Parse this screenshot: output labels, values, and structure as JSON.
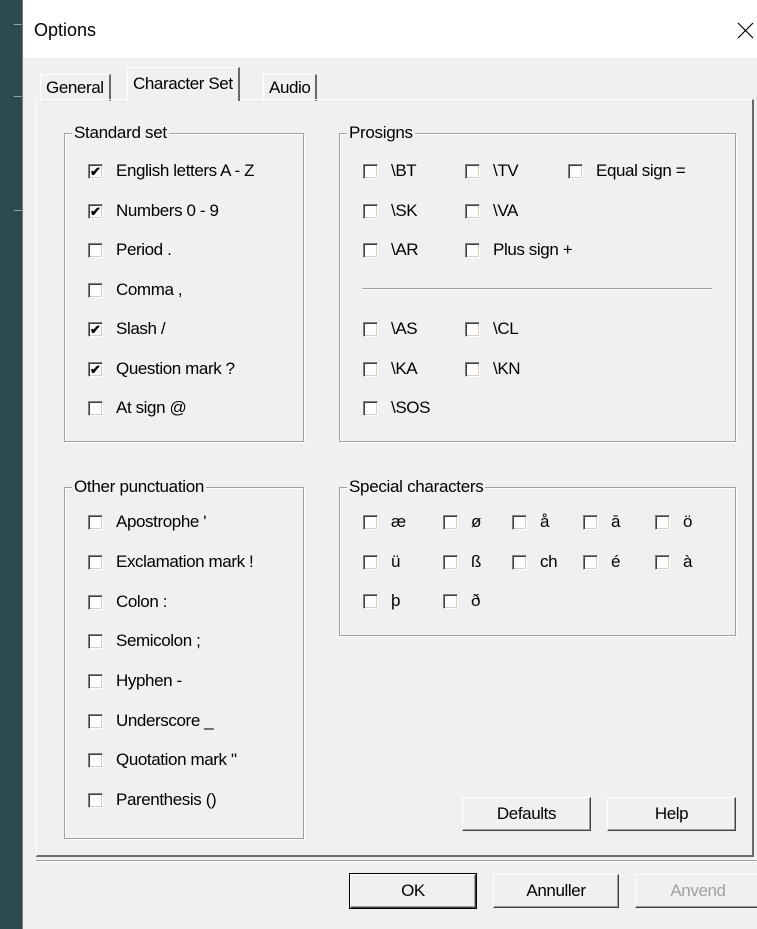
{
  "window": {
    "title": "Options"
  },
  "tabs": [
    {
      "label": "General",
      "active": false
    },
    {
      "label": "Character Set",
      "active": true
    },
    {
      "label": "Audio",
      "active": false
    }
  ],
  "standard_set": {
    "title": "Standard set",
    "items": [
      {
        "label": "English letters A - Z",
        "checked": true
      },
      {
        "label": "Numbers 0 - 9",
        "checked": true
      },
      {
        "label": "Period .",
        "checked": false
      },
      {
        "label": "Comma ,",
        "checked": false
      },
      {
        "label": "Slash /",
        "checked": true
      },
      {
        "label": "Question mark ?",
        "checked": true
      },
      {
        "label": "At sign @",
        "checked": false
      }
    ]
  },
  "prosigns": {
    "title": "Prosigns",
    "items": [
      {
        "label": "\\BT",
        "checked": false
      },
      {
        "label": "\\TV",
        "checked": false
      },
      {
        "label": "Equal sign =",
        "checked": false
      },
      {
        "label": "\\SK",
        "checked": false
      },
      {
        "label": "\\VA",
        "checked": false
      },
      {
        "label": "\\AR",
        "checked": false
      },
      {
        "label": "Plus sign +",
        "checked": false
      },
      {
        "label": "\\AS",
        "checked": false
      },
      {
        "label": "\\CL",
        "checked": false
      },
      {
        "label": "\\KA",
        "checked": false
      },
      {
        "label": "\\KN",
        "checked": false
      },
      {
        "label": "\\SOS",
        "checked": false
      }
    ]
  },
  "other_punctuation": {
    "title": "Other punctuation",
    "items": [
      {
        "label": "Apostrophe '",
        "checked": false
      },
      {
        "label": "Exclamation mark !",
        "checked": false
      },
      {
        "label": "Colon :",
        "checked": false
      },
      {
        "label": "Semicolon ;",
        "checked": false
      },
      {
        "label": "Hyphen -",
        "checked": false
      },
      {
        "label": "Underscore _",
        "checked": false
      },
      {
        "label": "Quotation mark \"",
        "checked": false
      },
      {
        "label": "Parenthesis ()",
        "checked": false
      }
    ]
  },
  "special_characters": {
    "title": "Special characters",
    "items": [
      {
        "label": "æ",
        "checked": false
      },
      {
        "label": "ø",
        "checked": false
      },
      {
        "label": "å",
        "checked": false
      },
      {
        "label": "ā",
        "checked": false
      },
      {
        "label": "ö",
        "checked": false
      },
      {
        "label": "ü",
        "checked": false
      },
      {
        "label": "ß",
        "checked": false
      },
      {
        "label": "ch",
        "checked": false
      },
      {
        "label": "é",
        "checked": false
      },
      {
        "label": "à",
        "checked": false
      },
      {
        "label": "þ",
        "checked": false
      },
      {
        "label": "ð",
        "checked": false
      }
    ]
  },
  "buttons": {
    "defaults": "Defaults",
    "help": "Help",
    "ok": "OK",
    "cancel": "Annuller",
    "apply": "Anvend"
  },
  "icons": {
    "close": "close-icon",
    "checkmark": "✔"
  }
}
